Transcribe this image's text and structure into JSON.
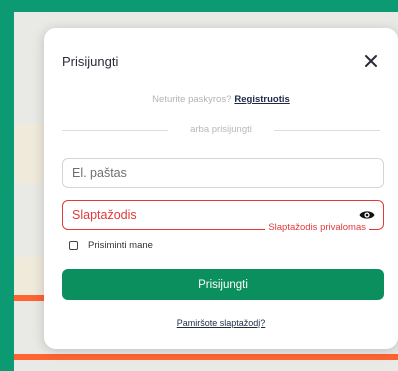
{
  "modal": {
    "title": "Prisijungti",
    "close_icon": "close-icon"
  },
  "signup": {
    "question": "Neturite paskyros?",
    "link": "Registruotis"
  },
  "divider": {
    "text": "arba prisijungti"
  },
  "form": {
    "email_placeholder": "El. paštas",
    "email_value": "",
    "password_placeholder": "Slaptažodis",
    "password_value": "",
    "password_error": "Slaptažodis privalomas",
    "password_toggle_icon": "eye-icon",
    "remember_label": "Prisiminti mane",
    "remember_checked": false,
    "submit_label": "Prisijungti"
  },
  "forgot_link": "Pamiršote slaptažodį?",
  "colors": {
    "primary": "#0b8f5f",
    "error": "#e03a3a",
    "background_green": "#0b9a71",
    "accent_strip": "#ff6433"
  }
}
